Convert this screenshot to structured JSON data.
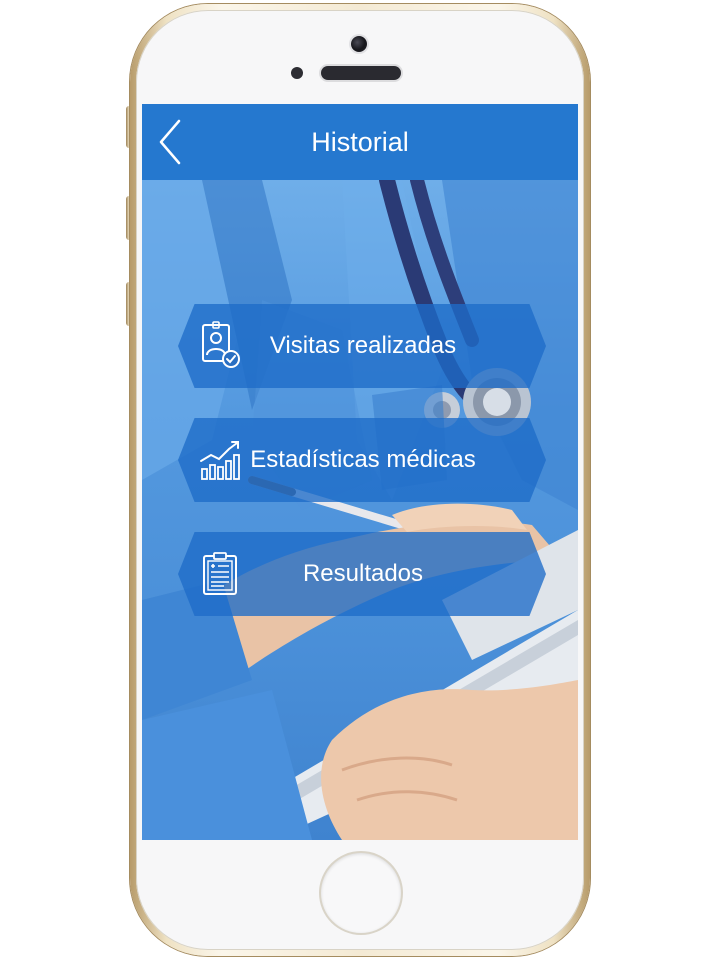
{
  "header": {
    "title": "Historial",
    "back_icon": "chevron-left-icon",
    "color": "#2578cf"
  },
  "menu": {
    "items": [
      {
        "label": "Visitas realizadas",
        "icon": "patient-badge-check-icon"
      },
      {
        "label": "Estadísticas médicas",
        "icon": "bar-chart-trend-icon"
      },
      {
        "label": "Resultados",
        "icon": "clipboard-medical-icon"
      }
    ],
    "button_color": "#1e6cc8"
  },
  "background": {
    "subject": "nurse-with-stethoscope-and-tablet",
    "tint": "#5499df"
  },
  "device": {
    "frame_color": "#efe2c4",
    "face_color": "#f7f7f8"
  }
}
